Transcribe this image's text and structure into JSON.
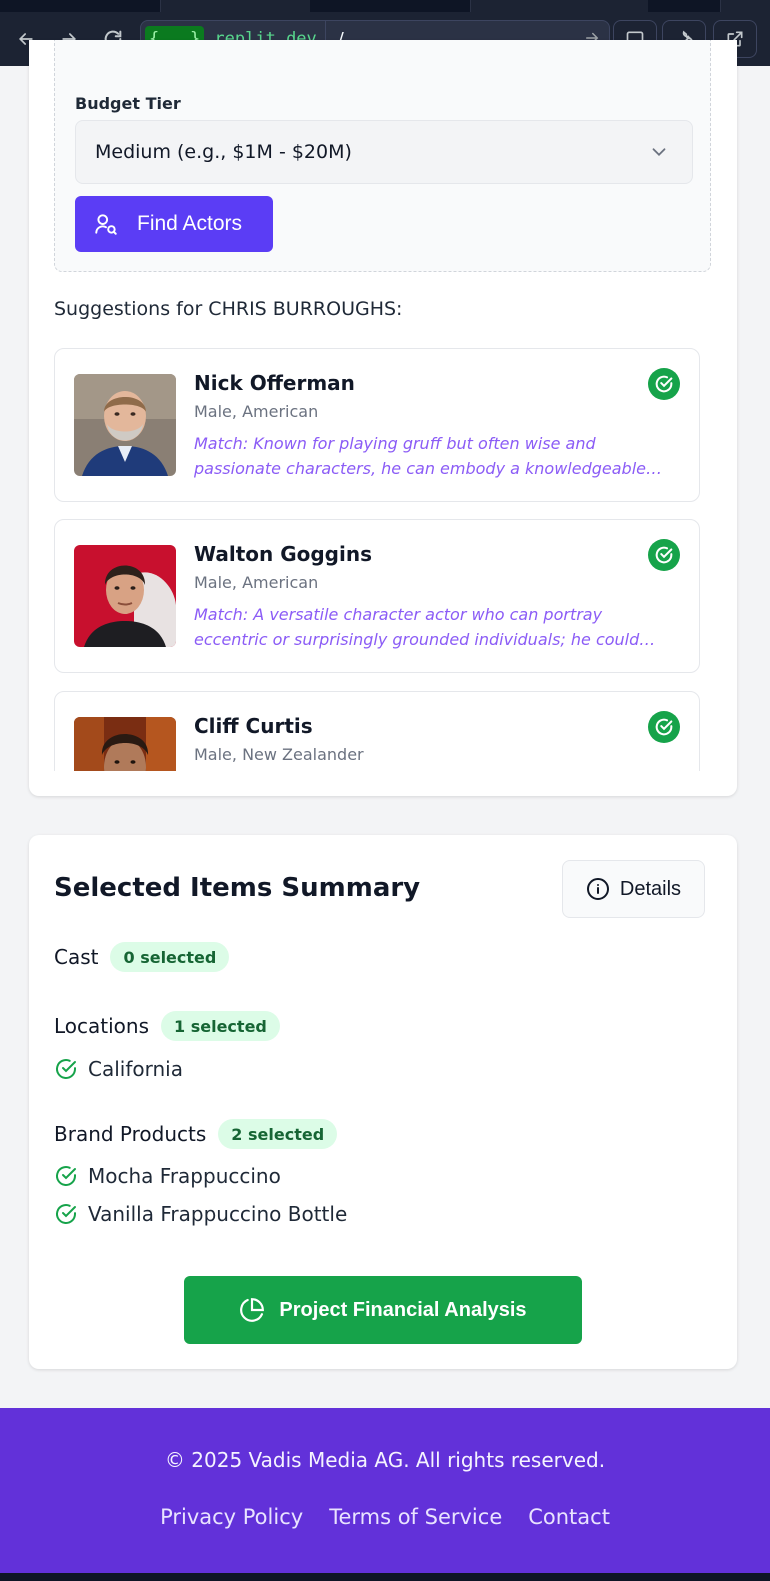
{
  "browser": {
    "url_host_brace": "{...}",
    "url_host": ".replit.dev",
    "url_path": "/"
  },
  "form": {
    "budget_label": "Budget Tier",
    "budget_value": "Medium (e.g., $1M - $20M)",
    "find_button": "Find Actors"
  },
  "suggestions": {
    "title": "Suggestions for CHRIS BURROUGHS:",
    "actors": [
      {
        "name": "Nick Offerman",
        "meta": "Male, American",
        "match": "Match: Known for playing gruff but often wise and passionate characters, he can embody a knowledgeable…"
      },
      {
        "name": "Walton Goggins",
        "meta": "Male, American",
        "match": "Match: A versatile character actor who can portray eccentric or surprisingly grounded individuals; he could…"
      },
      {
        "name": "Cliff Curtis",
        "meta": "Male, New Zealander",
        "match": ""
      }
    ]
  },
  "summary": {
    "title": "Selected Items Summary",
    "details_button": "Details",
    "cast": {
      "label": "Cast",
      "count": "0 selected"
    },
    "locations": {
      "label": "Locations",
      "count": "1 selected",
      "items": [
        "California"
      ]
    },
    "brand_products": {
      "label": "Brand Products",
      "count": "2 selected",
      "items": [
        "Mocha Frappuccino",
        "Vanilla Frappuccino Bottle"
      ]
    },
    "analysis_button": "Project Financial Analysis"
  },
  "footer": {
    "copyright": "© 2025 Vadis Media AG. All rights reserved.",
    "links": [
      "Privacy Policy",
      "Terms of Service",
      "Contact"
    ]
  },
  "colors": {
    "accent_purple": "#5b3df5",
    "success_green": "#16a34a",
    "footer_bg": "#6231d9"
  }
}
